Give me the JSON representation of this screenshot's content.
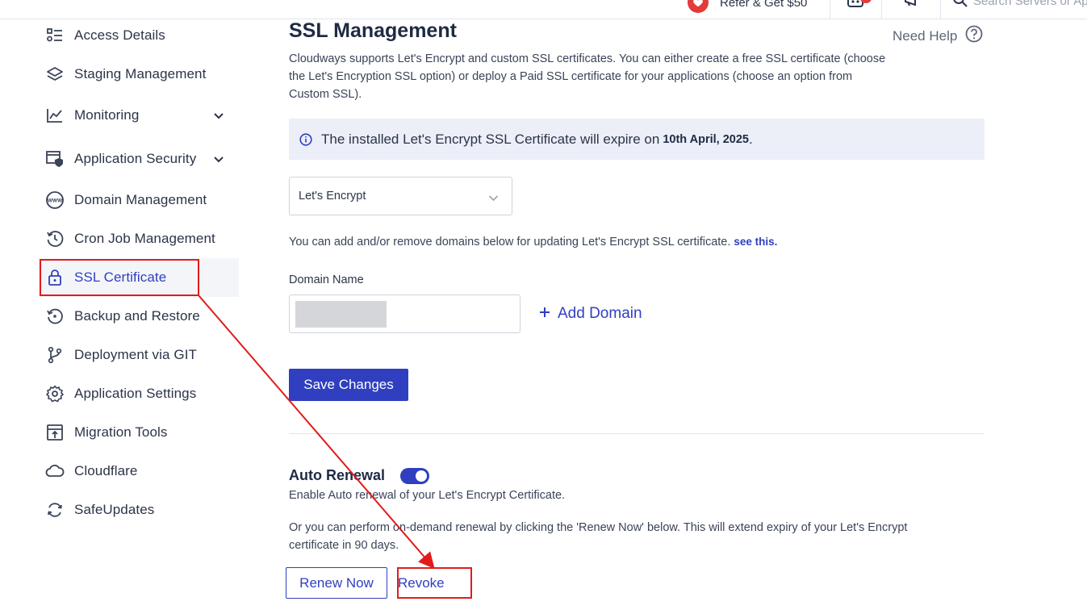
{
  "topbar": {
    "refer_label": "Refer & Get $50",
    "search_placeholder": "Search Servers or Ap"
  },
  "sidebar": {
    "items": [
      {
        "label": "Access Details",
        "icon": "access-details-icon"
      },
      {
        "label": "Staging Management",
        "icon": "layers-icon"
      },
      {
        "label": "Monitoring",
        "icon": "chart-line-icon"
      },
      {
        "label": "Application Security",
        "icon": "shield-window-icon"
      },
      {
        "label": "Domain Management",
        "icon": "www-icon"
      },
      {
        "label": "Cron Job Management",
        "icon": "history-icon"
      },
      {
        "label": "SSL Certificate",
        "icon": "lock-icon",
        "active": true
      },
      {
        "label": "Backup and Restore",
        "icon": "backup-icon"
      },
      {
        "label": "Deployment via GIT",
        "icon": "git-branch-icon"
      },
      {
        "label": "Application Settings",
        "icon": "gear-icon"
      },
      {
        "label": "Migration Tools",
        "icon": "migration-icon"
      },
      {
        "label": "Cloudflare",
        "icon": "cloud-icon"
      },
      {
        "label": "SafeUpdates",
        "icon": "refresh-icon"
      }
    ]
  },
  "main": {
    "title": "SSL Management",
    "need_help": "Need Help",
    "intro": "Cloudways supports Let's Encrypt and custom SSL certificates. You can either create a free SSL certificate (choose the Let's Encryption SSL option) or deploy a Paid SSL certificate for your applications (choose an option from Custom SSL).",
    "banner_text": "The installed Let's Encrypt SSL Certificate will expire on",
    "banner_date": "10th April, 2025",
    "banner_period": ".",
    "ssl_type_selected": "Let's Encrypt",
    "domains_note": "You can add and/or remove domains below for updating Let's Encrypt SSL certificate.",
    "see_this": "see this.",
    "domain_label": "Domain Name",
    "add_domain": "Add Domain",
    "save_label": "Save Changes",
    "auto_renewal_title": "Auto Renewal",
    "auto_renewal_enabled": true,
    "auto_renewal_desc": "Enable Auto renewal of your Let's Encrypt Certificate.",
    "renew_note": "Or you can perform on-demand renewal by clicking the 'Renew Now' below. This will extend expiry of your Let's Encrypt certificate in 90 days.",
    "renew_label": "Renew Now",
    "revoke_label": "Revoke"
  },
  "colors": {
    "accent": "#2f3fbf",
    "annotation": "#e21c1c",
    "banner_bg": "#eceef8"
  }
}
